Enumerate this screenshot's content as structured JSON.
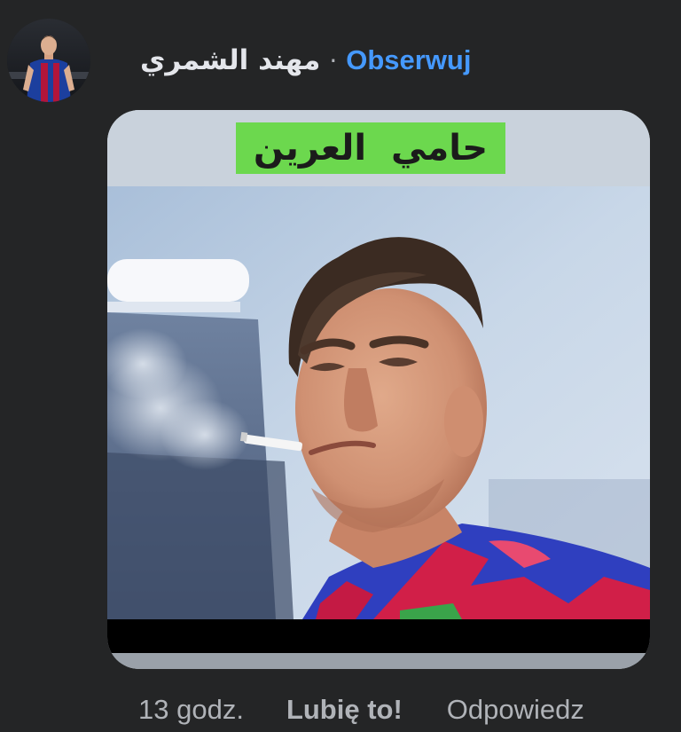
{
  "comment": {
    "author": "مهند الشمري",
    "separator": "·",
    "follow_label": "Obserwuj",
    "avatar_icon": "user-avatar-photo",
    "attachment": {
      "caption": "حامي العرين",
      "caption_bg": "#6cd84e",
      "image_icon": "goalkeeper-smoking-photo"
    },
    "actions": {
      "time": "13 godz.",
      "like_label": "Lubię to!",
      "reply_label": "Odpowiedz"
    }
  },
  "colors": {
    "background": "#242526",
    "link": "#4599ff",
    "text": "#e4e6eb",
    "muted": "#b0b3b8"
  }
}
